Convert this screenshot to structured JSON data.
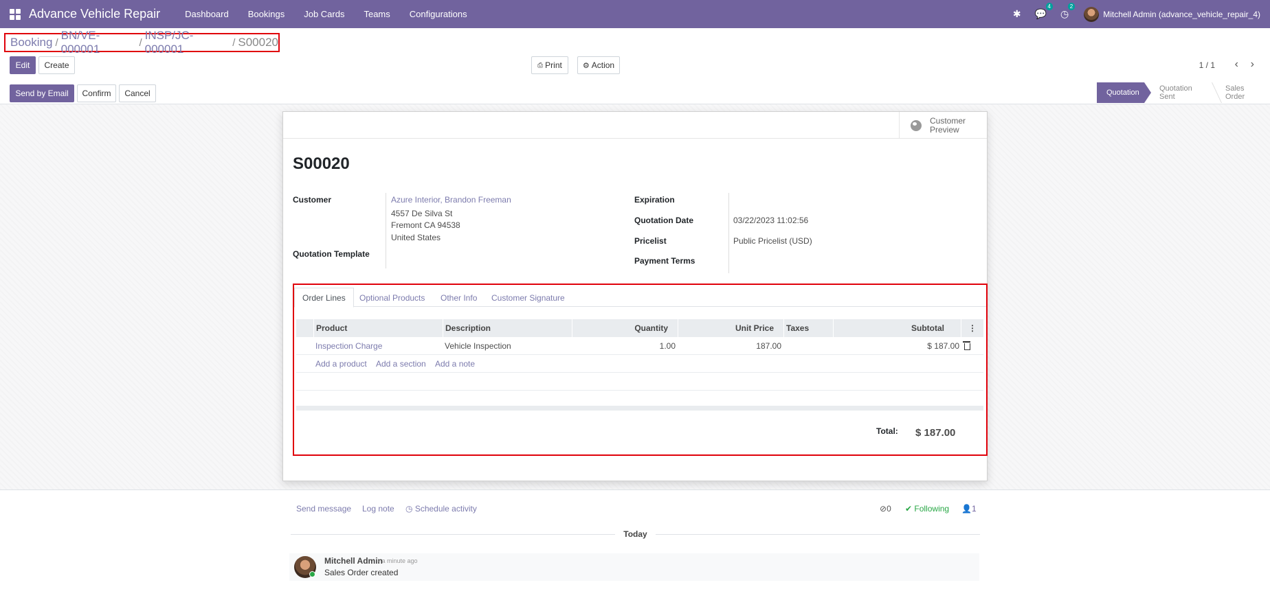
{
  "app": {
    "title": "Advance Vehicle Repair",
    "menu": [
      "Dashboard",
      "Bookings",
      "Job Cards",
      "Teams",
      "Configurations"
    ],
    "systray": {
      "messages_count": "4",
      "activities_count": "2",
      "user": "Mitchell Admin (advance_vehicle_repair_4)"
    }
  },
  "breadcrumb": {
    "items": [
      "Booking",
      "BN/VE-000001",
      "INSP/JC-000001"
    ],
    "current": "S00020",
    "sep": "/"
  },
  "buttons": {
    "edit": "Edit",
    "create": "Create",
    "print": "Print",
    "action": "Action",
    "send_email": "Send by Email",
    "confirm": "Confirm",
    "cancel": "Cancel"
  },
  "pager": {
    "value": "1 / 1"
  },
  "stages": {
    "items": [
      "Quotation",
      "Quotation Sent",
      "Sales Order"
    ],
    "active": "Quotation"
  },
  "form": {
    "customer_preview": "Customer Preview",
    "title": "S00020",
    "labels": {
      "customer": "Customer",
      "quotation_template": "Quotation Template",
      "expiration": "Expiration",
      "quotation_date": "Quotation Date",
      "pricelist": "Pricelist",
      "payment_terms": "Payment Terms"
    },
    "customer": {
      "name": "Azure Interior, Brandon Freeman",
      "street": "4557 De Silva St",
      "city": "Fremont CA 94538",
      "country": "United States"
    },
    "quotation_date": "03/22/2023 11:02:56",
    "pricelist": "Public Pricelist (USD)",
    "expiration": "",
    "payment_terms": "",
    "quotation_template": ""
  },
  "tabs": [
    "Order Lines",
    "Optional Products",
    "Other Info",
    "Customer Signature"
  ],
  "order_lines": {
    "columns": [
      "Product",
      "Description",
      "Quantity",
      "Unit Price",
      "Taxes",
      "Subtotal"
    ],
    "rows": [
      {
        "product": "Inspection Charge",
        "description": "Vehicle Inspection",
        "quantity": "1.00",
        "unit_price": "187.00",
        "taxes": "",
        "subtotal": "$ 187.00"
      }
    ],
    "add_links": [
      "Add a product",
      "Add a section",
      "Add a note"
    ],
    "total_label": "Total:",
    "total_value": "$ 187.00"
  },
  "chatter": {
    "send_message": "Send message",
    "log_note": "Log note",
    "schedule_activity": "Schedule activity",
    "attachments": "0",
    "following": "Following",
    "followers": "1",
    "today": "Today",
    "message": {
      "author": "Mitchell Admin",
      "date": "- a minute ago",
      "body": "Sales Order created"
    }
  },
  "colors": {
    "brand": "#71639e",
    "link": "#7c7bad",
    "highlight": "#e0000a",
    "following": "#28a745"
  },
  "icons": [
    "apps-icon",
    "bug-icon",
    "chat-icon",
    "clock-icon",
    "printer-icon",
    "gear-icon",
    "chevron-left-icon",
    "chevron-right-icon",
    "globe-icon",
    "trash-icon",
    "kebab-icon",
    "paperclip-icon",
    "check-icon",
    "user-icon"
  ]
}
